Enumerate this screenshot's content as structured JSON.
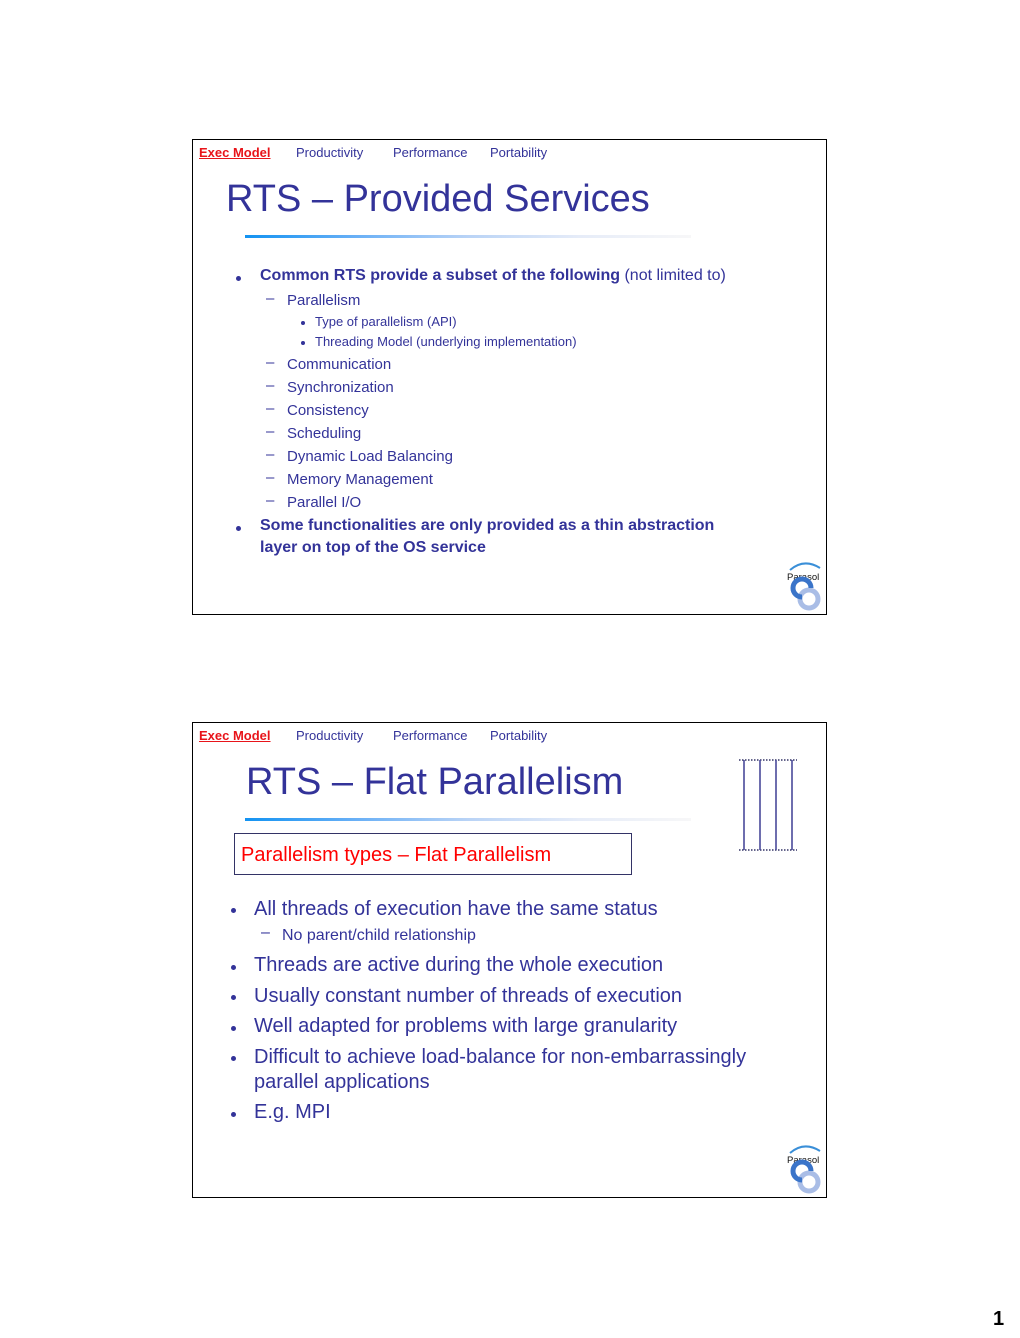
{
  "slides": [
    {
      "nav": {
        "items": [
          "Exec  Model",
          "Productivity",
          "Performance",
          "Portability"
        ],
        "active_index": 0
      },
      "title": "RTS – Provided Services",
      "bullets": [
        {
          "bold_text": "Common RTS provide a subset of the following",
          "normal_text": " (not limited to)",
          "sub_items": [
            {
              "text": "Parallelism",
              "sub_items": [
                "Type of parallelism (API)",
                "Threading Model (underlying implementation)"
              ]
            },
            {
              "text": "Communication"
            },
            {
              "text": "Synchronization"
            },
            {
              "text": "Consistency"
            },
            {
              "text": "Scheduling"
            },
            {
              "text": "Dynamic Load Balancing"
            },
            {
              "text": "Memory Management"
            },
            {
              "text": "Parallel I/O"
            }
          ]
        },
        {
          "bold_lines": [
            "Some functionalities are only provided as a thin abstraction",
            "layer on top of the OS service"
          ]
        }
      ],
      "logo_text": "Parasol"
    },
    {
      "nav": {
        "items": [
          "Exec  Model",
          "Productivity",
          "Performance",
          "Portability"
        ],
        "active_index": 0
      },
      "title": "RTS – Flat Parallelism",
      "callout": "Parallelism types – Flat Parallelism",
      "diagram": {
        "type": "flat-threads",
        "thread_count": 4
      },
      "bullets": [
        {
          "lines": [
            "All threads of execution have the same status"
          ],
          "sub_items": [
            "No parent/child relationship"
          ]
        },
        {
          "lines": [
            "Threads are active during the whole execution"
          ]
        },
        {
          "lines": [
            "Usually constant number of threads of execution"
          ]
        },
        {
          "lines": [
            "Well adapted for problems with large granularity"
          ]
        },
        {
          "lines": [
            "Difficult to achieve load-balance for non-embarrassingly",
            "parallel applications"
          ]
        },
        {
          "lines": [
            "E.g. MPI"
          ]
        }
      ],
      "logo_text": "Parasol"
    }
  ],
  "page_number": "1",
  "colors": {
    "text_primary": "#333399",
    "nav_active": "#e8141a",
    "callout_text": "#ff0000",
    "logo_blue": "#3a74c9",
    "logo_light": "#a9bde6"
  }
}
